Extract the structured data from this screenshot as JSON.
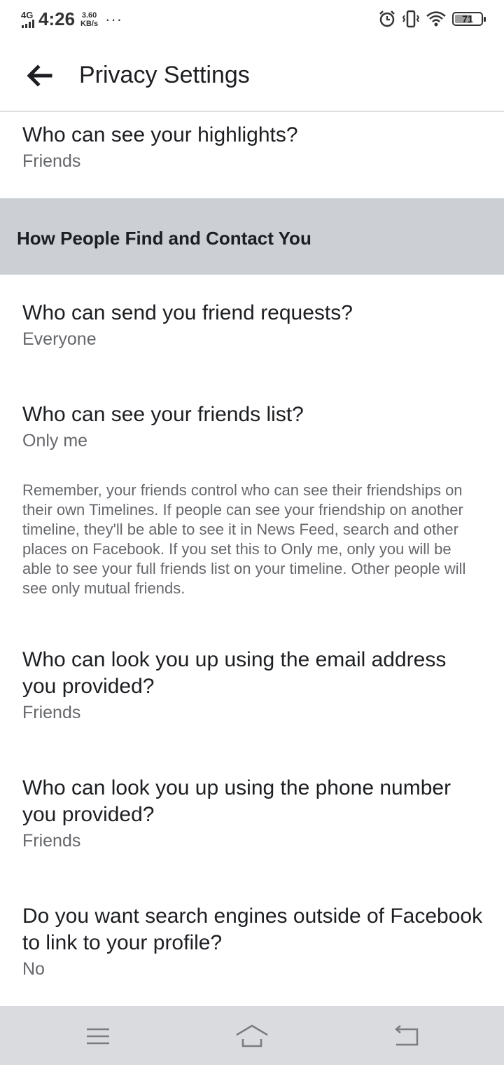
{
  "status_bar": {
    "network": "4G",
    "time": "4:26",
    "speed_value": "3.60",
    "speed_unit": "KB/s",
    "more": "···",
    "battery": "71",
    "battery_level": 0.71
  },
  "header": {
    "title": "Privacy Settings"
  },
  "settings": {
    "highlights": {
      "question": "Who can see your highlights?",
      "value": "Friends"
    },
    "section_title": "How People Find and Contact You",
    "friend_requests": {
      "question": "Who can send you friend requests?",
      "value": "Everyone"
    },
    "friends_list": {
      "question": "Who can see your friends list?",
      "value": "Only me"
    },
    "friends_list_note": "Remember, your friends control who can see their friendships on their own Timelines. If people can see your friendship on another timeline, they'll be able to see it in News Feed, search and other places on Facebook. If you set this to Only me, only you will be able to see your full friends list on your timeline. Other people will see only mutual friends.",
    "email_lookup": {
      "question": "Who can look you up using the email address you provided?",
      "value": "Friends"
    },
    "phone_lookup": {
      "question": "Who can look you up using the phone number you provided?",
      "value": "Friends"
    },
    "search_engines": {
      "question": "Do you want search engines outside of Facebook to link to your profile?",
      "value": "No"
    }
  },
  "icons": {
    "back": "back-arrow-icon",
    "alarm": "alarm-icon",
    "vibrate": "vibrate-icon",
    "wifi": "wifi-icon",
    "battery": "battery-icon",
    "menu": "menu-icon",
    "home": "home-icon",
    "nav_back": "nav-back-icon"
  }
}
